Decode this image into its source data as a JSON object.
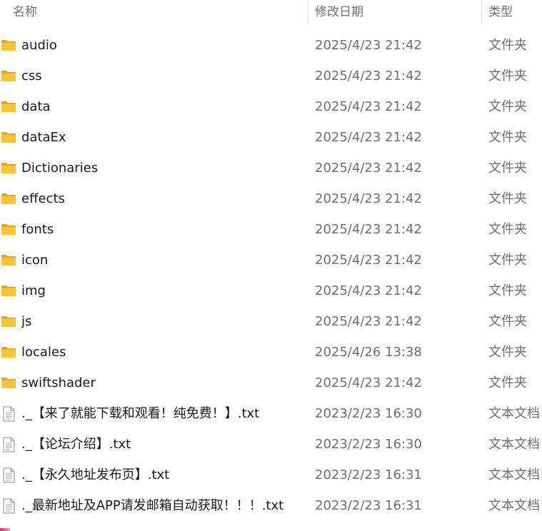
{
  "header": {
    "col_name": "名称",
    "col_date": "修改日期",
    "col_type": "类型",
    "sort_indicator": "^"
  },
  "files": [
    {
      "name": "audio",
      "date": "2025/4/23 21:42",
      "type": "文件夹",
      "kind": "folder"
    },
    {
      "name": "css",
      "date": "2025/4/23 21:42",
      "type": "文件夹",
      "kind": "folder"
    },
    {
      "name": "data",
      "date": "2025/4/23 21:42",
      "type": "文件夹",
      "kind": "folder"
    },
    {
      "name": "dataEx",
      "date": "2025/4/23 21:42",
      "type": "文件夹",
      "kind": "folder"
    },
    {
      "name": "Dictionaries",
      "date": "2025/4/23 21:42",
      "type": "文件夹",
      "kind": "folder"
    },
    {
      "name": "effects",
      "date": "2025/4/23 21:42",
      "type": "文件夹",
      "kind": "folder"
    },
    {
      "name": "fonts",
      "date": "2025/4/23 21:42",
      "type": "文件夹",
      "kind": "folder"
    },
    {
      "name": "icon",
      "date": "2025/4/23 21:42",
      "type": "文件夹",
      "kind": "folder"
    },
    {
      "name": "img",
      "date": "2025/4/23 21:42",
      "type": "文件夹",
      "kind": "folder"
    },
    {
      "name": "js",
      "date": "2025/4/23 21:42",
      "type": "文件夹",
      "kind": "folder"
    },
    {
      "name": "locales",
      "date": "2025/4/26 13:38",
      "type": "文件夹",
      "kind": "folder"
    },
    {
      "name": "swiftshader",
      "date": "2025/4/23 21:42",
      "type": "文件夹",
      "kind": "folder"
    },
    {
      "name": "._【来了就能下载和观看！纯免费！】.txt",
      "date": "2023/2/23 16:30",
      "type": "文本文档",
      "kind": "text"
    },
    {
      "name": "._【论坛介绍】.txt",
      "date": "2023/2/23 16:30",
      "type": "文本文档",
      "kind": "text"
    },
    {
      "name": "._【永久地址发布页】.txt",
      "date": "2023/2/23 16:31",
      "type": "文本文档",
      "kind": "text"
    },
    {
      "name": "._最新地址及APP请发邮箱自动获取！！！.txt",
      "date": "2023/2/23 16:31",
      "type": "文本文档",
      "kind": "text"
    }
  ],
  "colors": {
    "folder": "#f8c537",
    "folder_dark": "#e6a817",
    "text_icon_border": "#8a8a8a"
  }
}
